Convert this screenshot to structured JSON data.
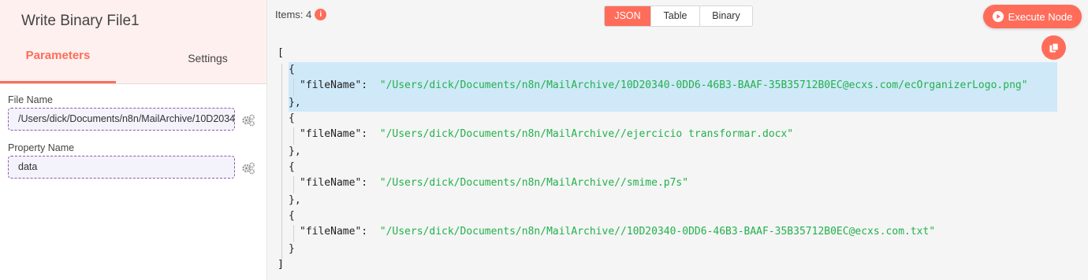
{
  "node": {
    "title": "Write Binary File1",
    "tabs": {
      "parameters": "Parameters",
      "settings": "Settings"
    }
  },
  "parameters": {
    "file_name": {
      "label": "File Name",
      "value": "/Users/dick/Documents/n8n/MailArchive/10D20340-0DD6-46B3-BAAF-35B35712B0EC@ecxs.com/ecOrganizerLogo.png"
    },
    "property_name": {
      "label": "Property Name",
      "value": "data"
    }
  },
  "output": {
    "items_label": "Items: 4",
    "info_icon": "i",
    "view_modes": [
      "JSON",
      "Table",
      "Binary"
    ],
    "active_view": "JSON",
    "execute_label": "Execute Node",
    "json": {
      "open_bracket": "[",
      "close_bracket": "]",
      "open_brace": "{",
      "close_brace_comma": "},",
      "close_brace": "}",
      "key": "\"fileName\":",
      "items": [
        "\"/Users/dick/Documents/n8n/MailArchive/10D20340-0DD6-46B3-BAAF-35B35712B0EC@ecxs.com/ecOrganizerLogo.png\"",
        "\"/Users/dick/Documents/n8n/MailArchive//ejercicio transformar.docx\"",
        "\"/Users/dick/Documents/n8n/MailArchive//smime.p7s\"",
        "\"/Users/dick/Documents/n8n/MailArchive//10D20340-0DD6-46B3-BAAF-35B35712B0EC@ecxs.com.txt\""
      ]
    }
  },
  "colors": {
    "accent": "#ff6d5a",
    "header_bg": "#fdf0ee",
    "json_string": "#22b14c",
    "highlight": "#cfe9f9",
    "input_border": "#8b5c9e"
  },
  "icons": [
    "info-icon",
    "gear-icon",
    "play-icon",
    "copy-icon"
  ]
}
